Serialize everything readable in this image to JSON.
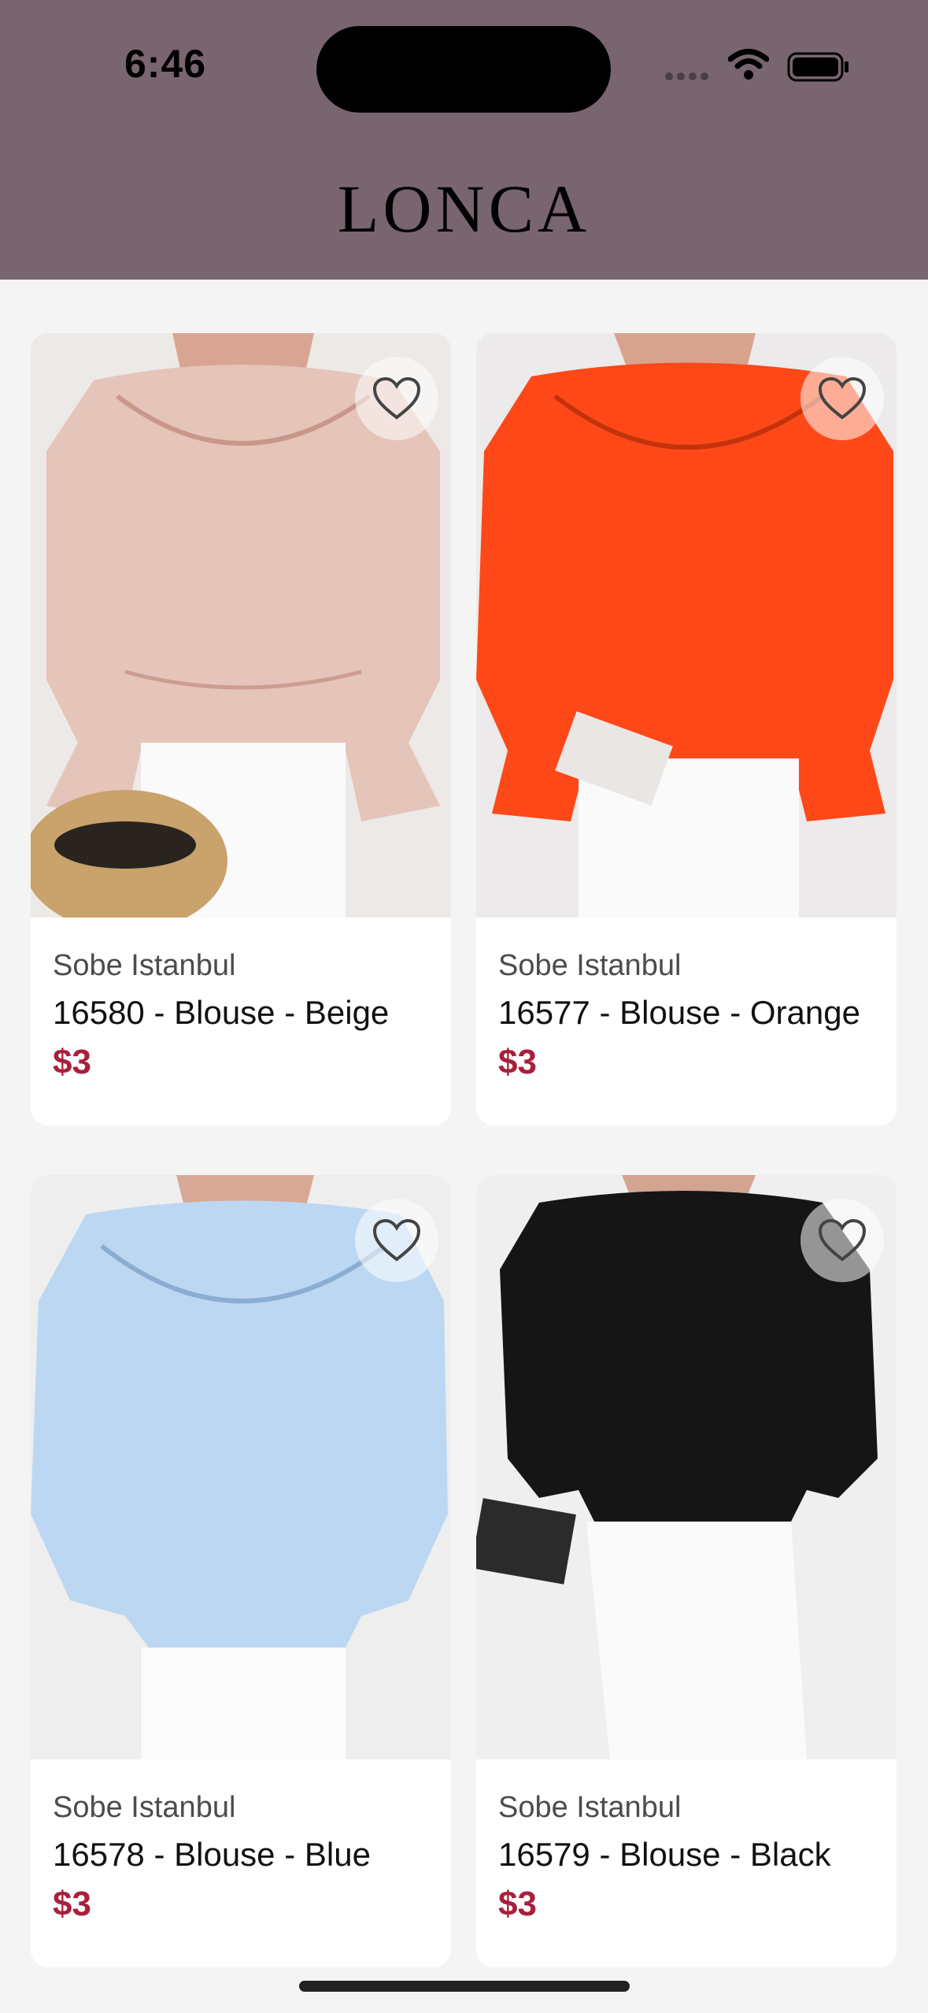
{
  "status_bar": {
    "time": "6:46"
  },
  "header": {
    "logo": "LONCA"
  },
  "products": [
    {
      "brand": "Sobe Istanbul",
      "name": "16580 - Blouse - Beige",
      "price": "$3",
      "color": "#e8c8bd"
    },
    {
      "brand": "Sobe Istanbul",
      "name": "16577 - Blouse - Orange",
      "price": "$3",
      "color": "#ff4a16"
    },
    {
      "brand": "Sobe Istanbul",
      "name": "16578 - Blouse - Blue",
      "price": "$3",
      "color": "#b9d6f1"
    },
    {
      "brand": "Sobe Istanbul",
      "name": "16579 - Blouse - Black",
      "price": "$3",
      "color": "#141414"
    }
  ],
  "colors": {
    "header_bg": "#79656f",
    "price": "#a8203b",
    "page_bg": "#f4f4f4"
  }
}
